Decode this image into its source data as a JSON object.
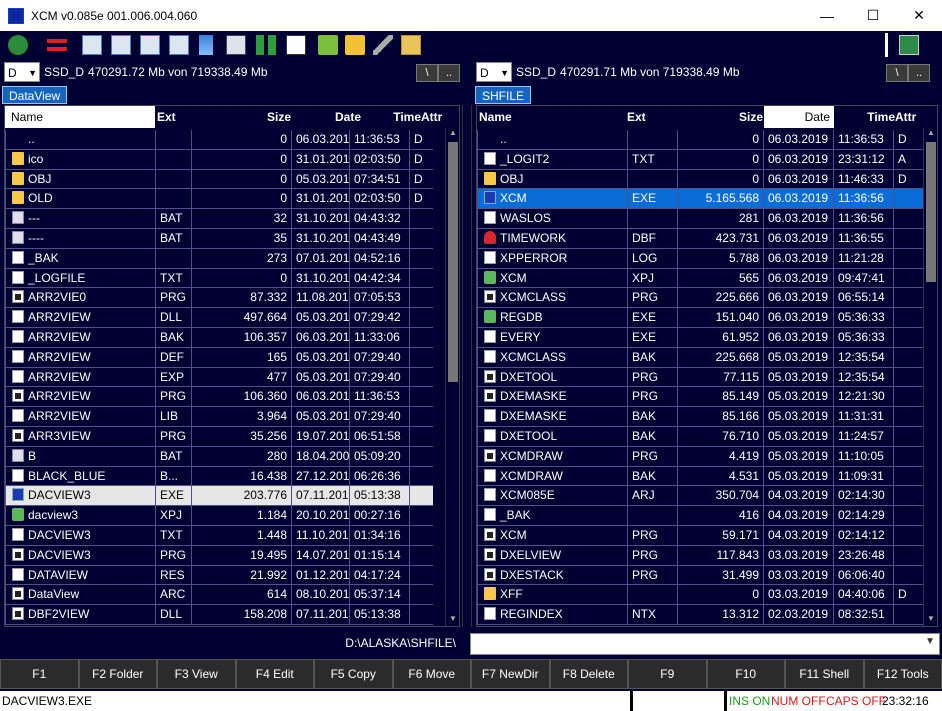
{
  "window": {
    "title": "XCM v0.085e 001.006.004.060",
    "minimize": "—",
    "maximize": "☐",
    "close": "✕"
  },
  "toolbar": {
    "icons": [
      "refresh-icon",
      "stop-icon",
      "view-icon-1",
      "view-icon-2",
      "view-icon-3",
      "view-icon-4",
      "sort-icon",
      "copy-icon",
      "download-icon",
      "calendar-icon",
      "upload-icon",
      "folder-open-icon",
      "edit-icon",
      "archive-icon",
      "panel-icon"
    ]
  },
  "left": {
    "drive": "D",
    "drive_label": "SSD_D",
    "drive_info": "470291.72 Mb von 719338.49 Mb",
    "btn_root": "\\",
    "btn_up": "..",
    "tab": "DataView",
    "headers": {
      "name": "Name",
      "ext": "Ext",
      "size": "Size",
      "date": "Date",
      "time": "Time",
      "attr": "Attr"
    },
    "rows": [
      {
        "icon": "blank",
        "name": "..",
        "ext": "",
        "size": "0",
        "date": "06.03.2019",
        "time": "11:36:53",
        "attr": "D"
      },
      {
        "icon": "folder",
        "name": "ico",
        "ext": "",
        "size": "0",
        "date": "31.01.2019",
        "time": "02:03:50",
        "attr": "D"
      },
      {
        "icon": "folder",
        "name": "OBJ",
        "ext": "",
        "size": "0",
        "date": "05.03.2019",
        "time": "07:34:51",
        "attr": "D"
      },
      {
        "icon": "folder",
        "name": "OLD",
        "ext": "",
        "size": "0",
        "date": "31.01.2019",
        "time": "02:03:50",
        "attr": "D"
      },
      {
        "icon": "bat",
        "name": "---",
        "ext": "BAT",
        "size": "32",
        "date": "31.10.2018",
        "time": "04:43:32",
        "attr": ""
      },
      {
        "icon": "bat",
        "name": "----",
        "ext": "BAT",
        "size": "35",
        "date": "31.10.2018",
        "time": "04:43:49",
        "attr": ""
      },
      {
        "icon": "doc",
        "name": "_BAK",
        "ext": "",
        "size": "273",
        "date": "07.01.2019",
        "time": "04:52:16",
        "attr": ""
      },
      {
        "icon": "doc",
        "name": "_LOGFILE",
        "ext": "TXT",
        "size": "0",
        "date": "31.10.2018",
        "time": "04:42:34",
        "attr": ""
      },
      {
        "icon": "prg",
        "name": "ARR2VIE0",
        "ext": "PRG",
        "size": "87.332",
        "date": "11.08.2018",
        "time": "07:05:53",
        "attr": ""
      },
      {
        "icon": "doc",
        "name": "ARR2VIEW",
        "ext": "DLL",
        "size": "497.664",
        "date": "05.03.2019",
        "time": "07:29:42",
        "attr": ""
      },
      {
        "icon": "doc",
        "name": "ARR2VIEW",
        "ext": "BAK",
        "size": "106.357",
        "date": "06.03.2019",
        "time": "11:33:06",
        "attr": ""
      },
      {
        "icon": "doc",
        "name": "ARR2VIEW",
        "ext": "DEF",
        "size": "165",
        "date": "05.03.2019",
        "time": "07:29:40",
        "attr": ""
      },
      {
        "icon": "doc",
        "name": "ARR2VIEW",
        "ext": "EXP",
        "size": "477",
        "date": "05.03.2019",
        "time": "07:29:40",
        "attr": ""
      },
      {
        "icon": "prg",
        "name": "ARR2VIEW",
        "ext": "PRG",
        "size": "106.360",
        "date": "06.03.2019",
        "time": "11:36:53",
        "attr": ""
      },
      {
        "icon": "doc",
        "name": "ARR2VIEW",
        "ext": "LIB",
        "size": "3.964",
        "date": "05.03.2019",
        "time": "07:29:40",
        "attr": ""
      },
      {
        "icon": "prg",
        "name": "ARR3VIEW",
        "ext": "PRG",
        "size": "35.256",
        "date": "19.07.2018",
        "time": "06:51:58",
        "attr": ""
      },
      {
        "icon": "bat",
        "name": "B",
        "ext": "BAT",
        "size": "280",
        "date": "18.04.2008",
        "time": "05:09:20",
        "attr": ""
      },
      {
        "icon": "doc",
        "name": "BLACK_BLUE",
        "ext": "B...",
        "size": "16.438",
        "date": "27.12.2011",
        "time": "06:26:36",
        "attr": ""
      },
      {
        "icon": "exe",
        "name": "DACVIEW3",
        "ext": "EXE",
        "size": "203.776",
        "date": "07.11.2015",
        "time": "05:13:38",
        "attr": "",
        "state": "sel"
      },
      {
        "icon": "gear",
        "name": "dacview3",
        "ext": "XPJ",
        "size": "1.184",
        "date": "20.10.2015",
        "time": "00:27:16",
        "attr": ""
      },
      {
        "icon": "doc",
        "name": "DACVIEW3",
        "ext": "TXT",
        "size": "1.448",
        "date": "11.10.2015",
        "time": "01:34:16",
        "attr": ""
      },
      {
        "icon": "prg",
        "name": "DACVIEW3",
        "ext": "PRG",
        "size": "19.495",
        "date": "14.07.2018",
        "time": "01:15:14",
        "attr": ""
      },
      {
        "icon": "doc",
        "name": "DATAVIEW",
        "ext": "RES",
        "size": "21.992",
        "date": "01.12.2015",
        "time": "04:17:24",
        "attr": ""
      },
      {
        "icon": "prg",
        "name": "DataView",
        "ext": "ARC",
        "size": "614",
        "date": "08.10.2015",
        "time": "05:37:14",
        "attr": ""
      },
      {
        "icon": "prg",
        "name": "DBF2VIEW",
        "ext": "DLL",
        "size": "158.208",
        "date": "07.11.2015",
        "time": "05:13:38",
        "attr": ""
      }
    ]
  },
  "right": {
    "drive": "D",
    "drive_label": "SSD_D",
    "drive_info": "470291.71 Mb von 719338.49 Mb",
    "btn_root": "\\",
    "btn_up": "..",
    "tab": "SHFILE",
    "headers": {
      "name": "Name",
      "ext": "Ext",
      "size": "Size",
      "date": "Date",
      "time": "Time",
      "attr": "Attr"
    },
    "rows": [
      {
        "icon": "blank",
        "name": "..",
        "ext": "",
        "size": "0",
        "date": "06.03.2019",
        "time": "11:36:53",
        "attr": "D"
      },
      {
        "icon": "doc",
        "name": "_LOGIT2",
        "ext": "TXT",
        "size": "0",
        "date": "06.03.2019",
        "time": "23:31:12",
        "attr": "A"
      },
      {
        "icon": "folder",
        "name": "OBJ",
        "ext": "",
        "size": "0",
        "date": "06.03.2019",
        "time": "11:46:33",
        "attr": "D"
      },
      {
        "icon": "exe",
        "name": "XCM",
        "ext": "EXE",
        "size": "5.165.568",
        "date": "06.03.2019",
        "time": "11:36:56",
        "attr": "",
        "state": "cur"
      },
      {
        "icon": "doc",
        "name": "WASLOS",
        "ext": "",
        "size": "281",
        "date": "06.03.2019",
        "time": "11:36:56",
        "attr": ""
      },
      {
        "icon": "red",
        "name": "TIMEWORK",
        "ext": "DBF",
        "size": "423.731",
        "date": "06.03.2019",
        "time": "11:36:55",
        "attr": ""
      },
      {
        "icon": "doc",
        "name": "XPPERROR",
        "ext": "LOG",
        "size": "5.788",
        "date": "06.03.2019",
        "time": "11:21:28",
        "attr": ""
      },
      {
        "icon": "gear",
        "name": "XCM",
        "ext": "XPJ",
        "size": "565",
        "date": "06.03.2019",
        "time": "09:47:41",
        "attr": ""
      },
      {
        "icon": "prg",
        "name": "XCMCLASS",
        "ext": "PRG",
        "size": "225.666",
        "date": "06.03.2019",
        "time": "06:55:14",
        "attr": ""
      },
      {
        "icon": "gear",
        "name": "REGDB",
        "ext": "EXE",
        "size": "151.040",
        "date": "06.03.2019",
        "time": "05:36:33",
        "attr": ""
      },
      {
        "icon": "doc",
        "name": "EVERY",
        "ext": "EXE",
        "size": "61.952",
        "date": "06.03.2019",
        "time": "05:36:33",
        "attr": ""
      },
      {
        "icon": "doc",
        "name": "XCMCLASS",
        "ext": "BAK",
        "size": "225.668",
        "date": "05.03.2019",
        "time": "12:35:54",
        "attr": ""
      },
      {
        "icon": "prg",
        "name": "DXETOOL",
        "ext": "PRG",
        "size": "77.115",
        "date": "05.03.2019",
        "time": "12:35:54",
        "attr": ""
      },
      {
        "icon": "prg",
        "name": "DXEMASKE",
        "ext": "PRG",
        "size": "85.149",
        "date": "05.03.2019",
        "time": "12:21:30",
        "attr": ""
      },
      {
        "icon": "doc",
        "name": "DXEMASKE",
        "ext": "BAK",
        "size": "85.166",
        "date": "05.03.2019",
        "time": "11:31:31",
        "attr": ""
      },
      {
        "icon": "doc",
        "name": "DXETOOL",
        "ext": "BAK",
        "size": "76.710",
        "date": "05.03.2019",
        "time": "11:24:57",
        "attr": ""
      },
      {
        "icon": "prg",
        "name": "XCMDRAW",
        "ext": "PRG",
        "size": "4.419",
        "date": "05.03.2019",
        "time": "11:10:05",
        "attr": ""
      },
      {
        "icon": "doc",
        "name": "XCMDRAW",
        "ext": "BAK",
        "size": "4.531",
        "date": "05.03.2019",
        "time": "11:09:31",
        "attr": ""
      },
      {
        "icon": "doc",
        "name": "XCM085E",
        "ext": "ARJ",
        "size": "350.704",
        "date": "04.03.2019",
        "time": "02:14:30",
        "attr": ""
      },
      {
        "icon": "doc",
        "name": "_BAK",
        "ext": "",
        "size": "416",
        "date": "04.03.2019",
        "time": "02:14:29",
        "attr": ""
      },
      {
        "icon": "prg",
        "name": "XCM",
        "ext": "PRG",
        "size": "59.171",
        "date": "04.03.2019",
        "time": "02:14:12",
        "attr": ""
      },
      {
        "icon": "prg",
        "name": "DXELVIEW",
        "ext": "PRG",
        "size": "117.843",
        "date": "03.03.2019",
        "time": "23:26:48",
        "attr": ""
      },
      {
        "icon": "prg",
        "name": "DXESTACK",
        "ext": "PRG",
        "size": "31.499",
        "date": "03.03.2019",
        "time": "06:06:40",
        "attr": ""
      },
      {
        "icon": "folder",
        "name": "XFF",
        "ext": "",
        "size": "0",
        "date": "03.03.2019",
        "time": "04:40:06",
        "attr": "D"
      },
      {
        "icon": "doc",
        "name": "REGINDEX",
        "ext": "NTX",
        "size": "13.312",
        "date": "02.03.2019",
        "time": "08:32:51",
        "attr": ""
      }
    ]
  },
  "path": "D:\\ALASKA\\SHFILE\\",
  "fkeys": [
    "F1",
    "F2 Folder",
    "F3 View",
    "F4 Edit",
    "F5 Copy",
    "F6 Move",
    "F7 NewDir",
    "F8 Delete",
    "F9",
    "F10",
    "F11 Shell",
    "F12 Tools"
  ],
  "status": {
    "file": "DACVIEW3.EXE",
    "ins": "INS ON",
    "num": "NUM OFF",
    "caps": "CAPS OFF",
    "clock": "23:32:16",
    "colors": {
      "ins": "#1a9e1a",
      "num": "#d61a1a",
      "caps": "#d61a1a",
      "clock": "#000000"
    }
  }
}
